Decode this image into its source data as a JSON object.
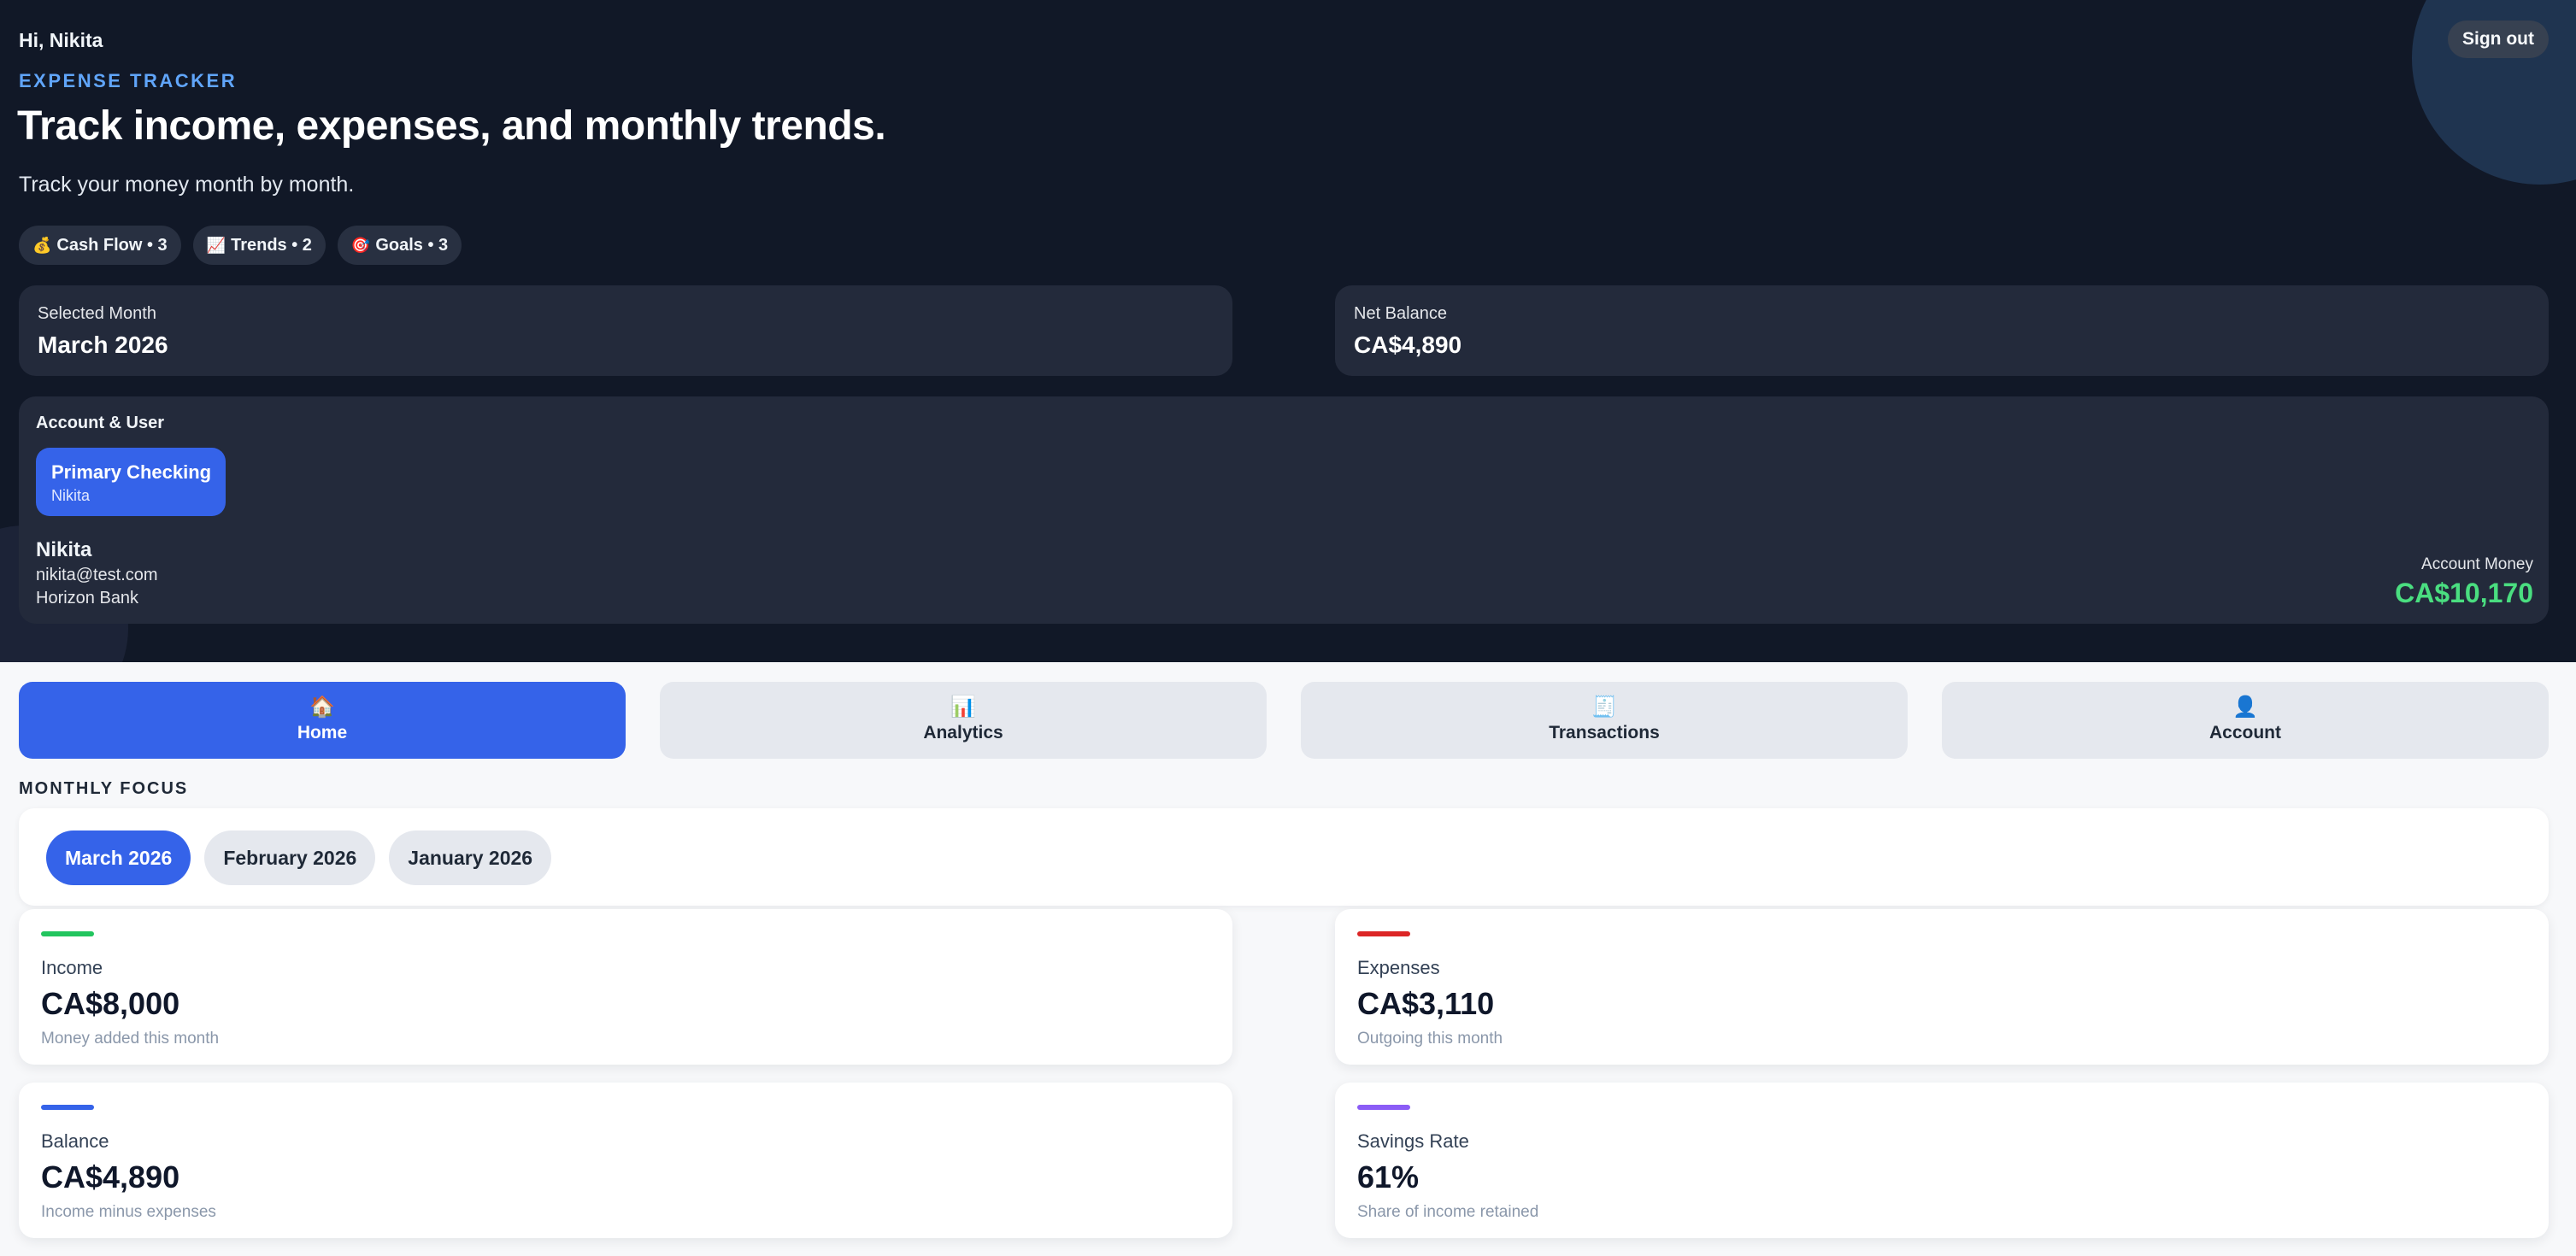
{
  "header": {
    "greeting": "Hi, Nikita",
    "signout_label": "Sign out",
    "kicker": "EXPENSE TRACKER",
    "headline": "Track income, expenses, and monthly trends.",
    "tagline": "Track your money month by month."
  },
  "chips": [
    {
      "icon": "💰",
      "icon_name": "money-bag-icon",
      "label": "Cash Flow • 3"
    },
    {
      "icon": "📈",
      "icon_name": "chart-up-icon",
      "label": "Trends • 2"
    },
    {
      "icon": "🎯",
      "icon_name": "target-icon",
      "label": "Goals • 3"
    }
  ],
  "summary": {
    "selected_month_label": "Selected Month",
    "selected_month_value": "March 2026",
    "net_balance_label": "Net Balance",
    "net_balance_value": "CA$4,890"
  },
  "account": {
    "title": "Account & User",
    "account_name": "Primary Checking",
    "account_owner": "Nikita",
    "user_name": "Nikita",
    "user_email": "nikita@test.com",
    "bank": "Horizon Bank",
    "money_label": "Account Money",
    "money_value": "CA$10,170",
    "money_color": "#4ade80"
  },
  "nav": [
    {
      "icon": "🏠",
      "icon_name": "home-icon",
      "label": "Home",
      "active": true
    },
    {
      "icon": "📊",
      "icon_name": "bar-chart-icon",
      "label": "Analytics",
      "active": false
    },
    {
      "icon": "🧾",
      "icon_name": "receipt-icon",
      "label": "Transactions",
      "active": false
    },
    {
      "icon": "👤",
      "icon_name": "user-icon",
      "label": "Account",
      "active": false
    }
  ],
  "focus": {
    "label": "MONTHLY FOCUS",
    "months": [
      "March 2026",
      "February 2026",
      "January 2026"
    ],
    "selected": "March 2026"
  },
  "cards": [
    {
      "label": "Income",
      "value": "CA$8,000",
      "sub": "Money added this month",
      "color": "#22c55e"
    },
    {
      "label": "Expenses",
      "value": "CA$3,110",
      "sub": "Outgoing this month",
      "color": "#dc2626"
    },
    {
      "label": "Balance",
      "value": "CA$4,890",
      "sub": "Income minus expenses",
      "color": "#3563e9"
    },
    {
      "label": "Savings Rate",
      "value": "61%",
      "sub": "Share of income retained",
      "color": "#8b5cf6"
    }
  ],
  "colors": {
    "accent": "#3563e9",
    "hero_bg": "#111827",
    "kicker": "#60a5fa"
  }
}
